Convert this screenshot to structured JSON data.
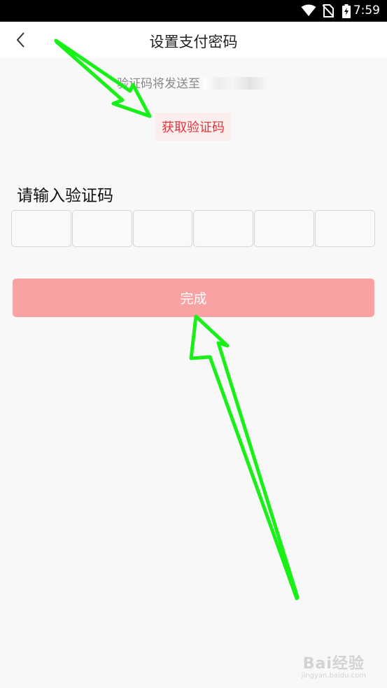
{
  "status_bar": {
    "time": "7:59",
    "icons": [
      "wifi-icon",
      "no-sim-icon",
      "battery-charging-icon"
    ]
  },
  "nav": {
    "back_icon": "chevron-left-icon",
    "title": "设置支付密码"
  },
  "sent_to": {
    "text": "验证码将发送至",
    "phone": ""
  },
  "get_code": {
    "label": "获取验证码",
    "color": "#e0353f"
  },
  "code_input": {
    "heading": "请输入验证码",
    "boxes": [
      "",
      "",
      "",
      "",
      "",
      ""
    ]
  },
  "done_button": {
    "label": "完成",
    "color": "#f8a2a3"
  },
  "annotations": {
    "arrow_color": "#18f018"
  },
  "watermark": {
    "logo": "Bai经验",
    "url": "jingyan.baidu.com"
  }
}
